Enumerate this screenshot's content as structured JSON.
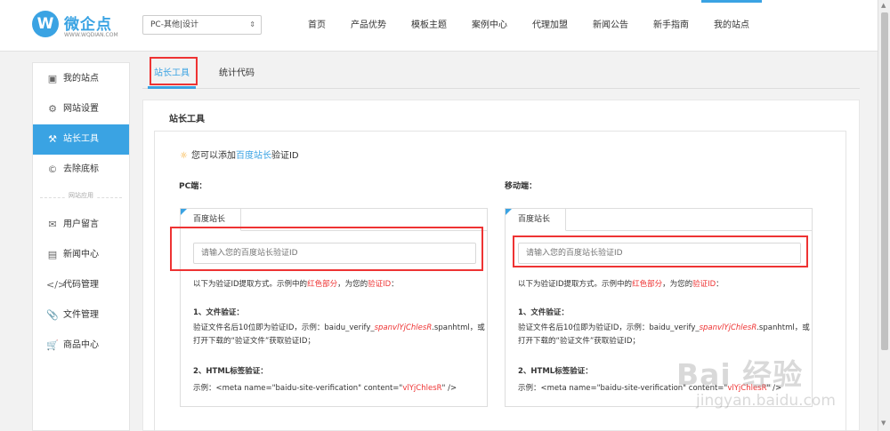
{
  "brand": {
    "logo_letter": "W",
    "name": "微企点",
    "url": "WWW.WQDIAN.COM"
  },
  "site_select": {
    "value": "PC-其他|设计"
  },
  "nav": [
    "首页",
    "产品优势",
    "模板主题",
    "案例中心",
    "代理加盟",
    "新闻公告",
    "新手指南",
    "我的站点"
  ],
  "nav_active_index": 7,
  "sidebar": {
    "items_top": [
      {
        "label": "我的站点",
        "icon": "monitor-icon"
      },
      {
        "label": "网站设置",
        "icon": "gear-icon"
      },
      {
        "label": "站长工具",
        "icon": "wrench-icon"
      },
      {
        "label": "去除底标",
        "icon": "copyright-icon"
      }
    ],
    "divider": "网站应用",
    "items_bottom": [
      {
        "label": "用户留言",
        "icon": "message-icon"
      },
      {
        "label": "新闻中心",
        "icon": "news-icon"
      },
      {
        "label": "代码管理",
        "icon": "code-icon"
      },
      {
        "label": "文件管理",
        "icon": "paperclip-icon"
      },
      {
        "label": "商品中心",
        "icon": "cart-icon"
      }
    ],
    "active": "站长工具"
  },
  "tabs": {
    "tab1": "站长工具",
    "tab2": "统计代码"
  },
  "card_title": "站长工具",
  "hint": {
    "prefix": "您可以添加",
    "link": "百度站长",
    "suffix": "验证ID"
  },
  "pc": {
    "label": "PC端：",
    "tab": "百度站长",
    "placeholder": "请输入您的百度站长验证ID",
    "l1a": "以下为验证ID提取方式。示例中的",
    "l1b": "红色部分",
    "l1c": "，为您的",
    "l1d": "验证ID",
    "l1e": "：",
    "h1": "1、文件验证：",
    "l2a": "验证文件名后10位即为验证ID，示例：baidu_verify_",
    "l2b": "spanvlYjChlesR",
    "l2c": ".spanhtml，或",
    "l3": "打开下载的“验证文件”获取验证ID；",
    "h2": "2、HTML标签验证：",
    "l4a": "示例：<meta name=\"baidu-site-verification\" content=\"",
    "l4b": "vlYjChlesR",
    "l4c": "\" />"
  },
  "mobile": {
    "label": "移动端：",
    "tab": "百度站长",
    "placeholder": "请输入您的百度站长验证ID",
    "l1a": "以下为验证ID提取方式。示例中的",
    "l1b": "红色部分",
    "l1c": "，为您的",
    "l1d": "验证ID",
    "l1e": "：",
    "h1": "1、文件验证：",
    "l2a": "验证文件名后10位即为验证ID，示例：baidu_verify_",
    "l2b": "spanvlYjChlesR",
    "l2c": ".spanhtml，或",
    "l3": "打开下载的“验证文件”获取验证ID；",
    "h2": "2、HTML标签验证：",
    "l4a": "示例：<meta name=\"baidu-site-verification\" content=\"",
    "l4b": "vlYjChlesR",
    "l4c": "\" />"
  },
  "watermark": {
    "main": "Bai 经验",
    "sub": "jingyan.baidu.com"
  },
  "colors": {
    "accent": "#3aa3e3",
    "highlight_box": "#e33",
    "example_red": "#e33"
  }
}
